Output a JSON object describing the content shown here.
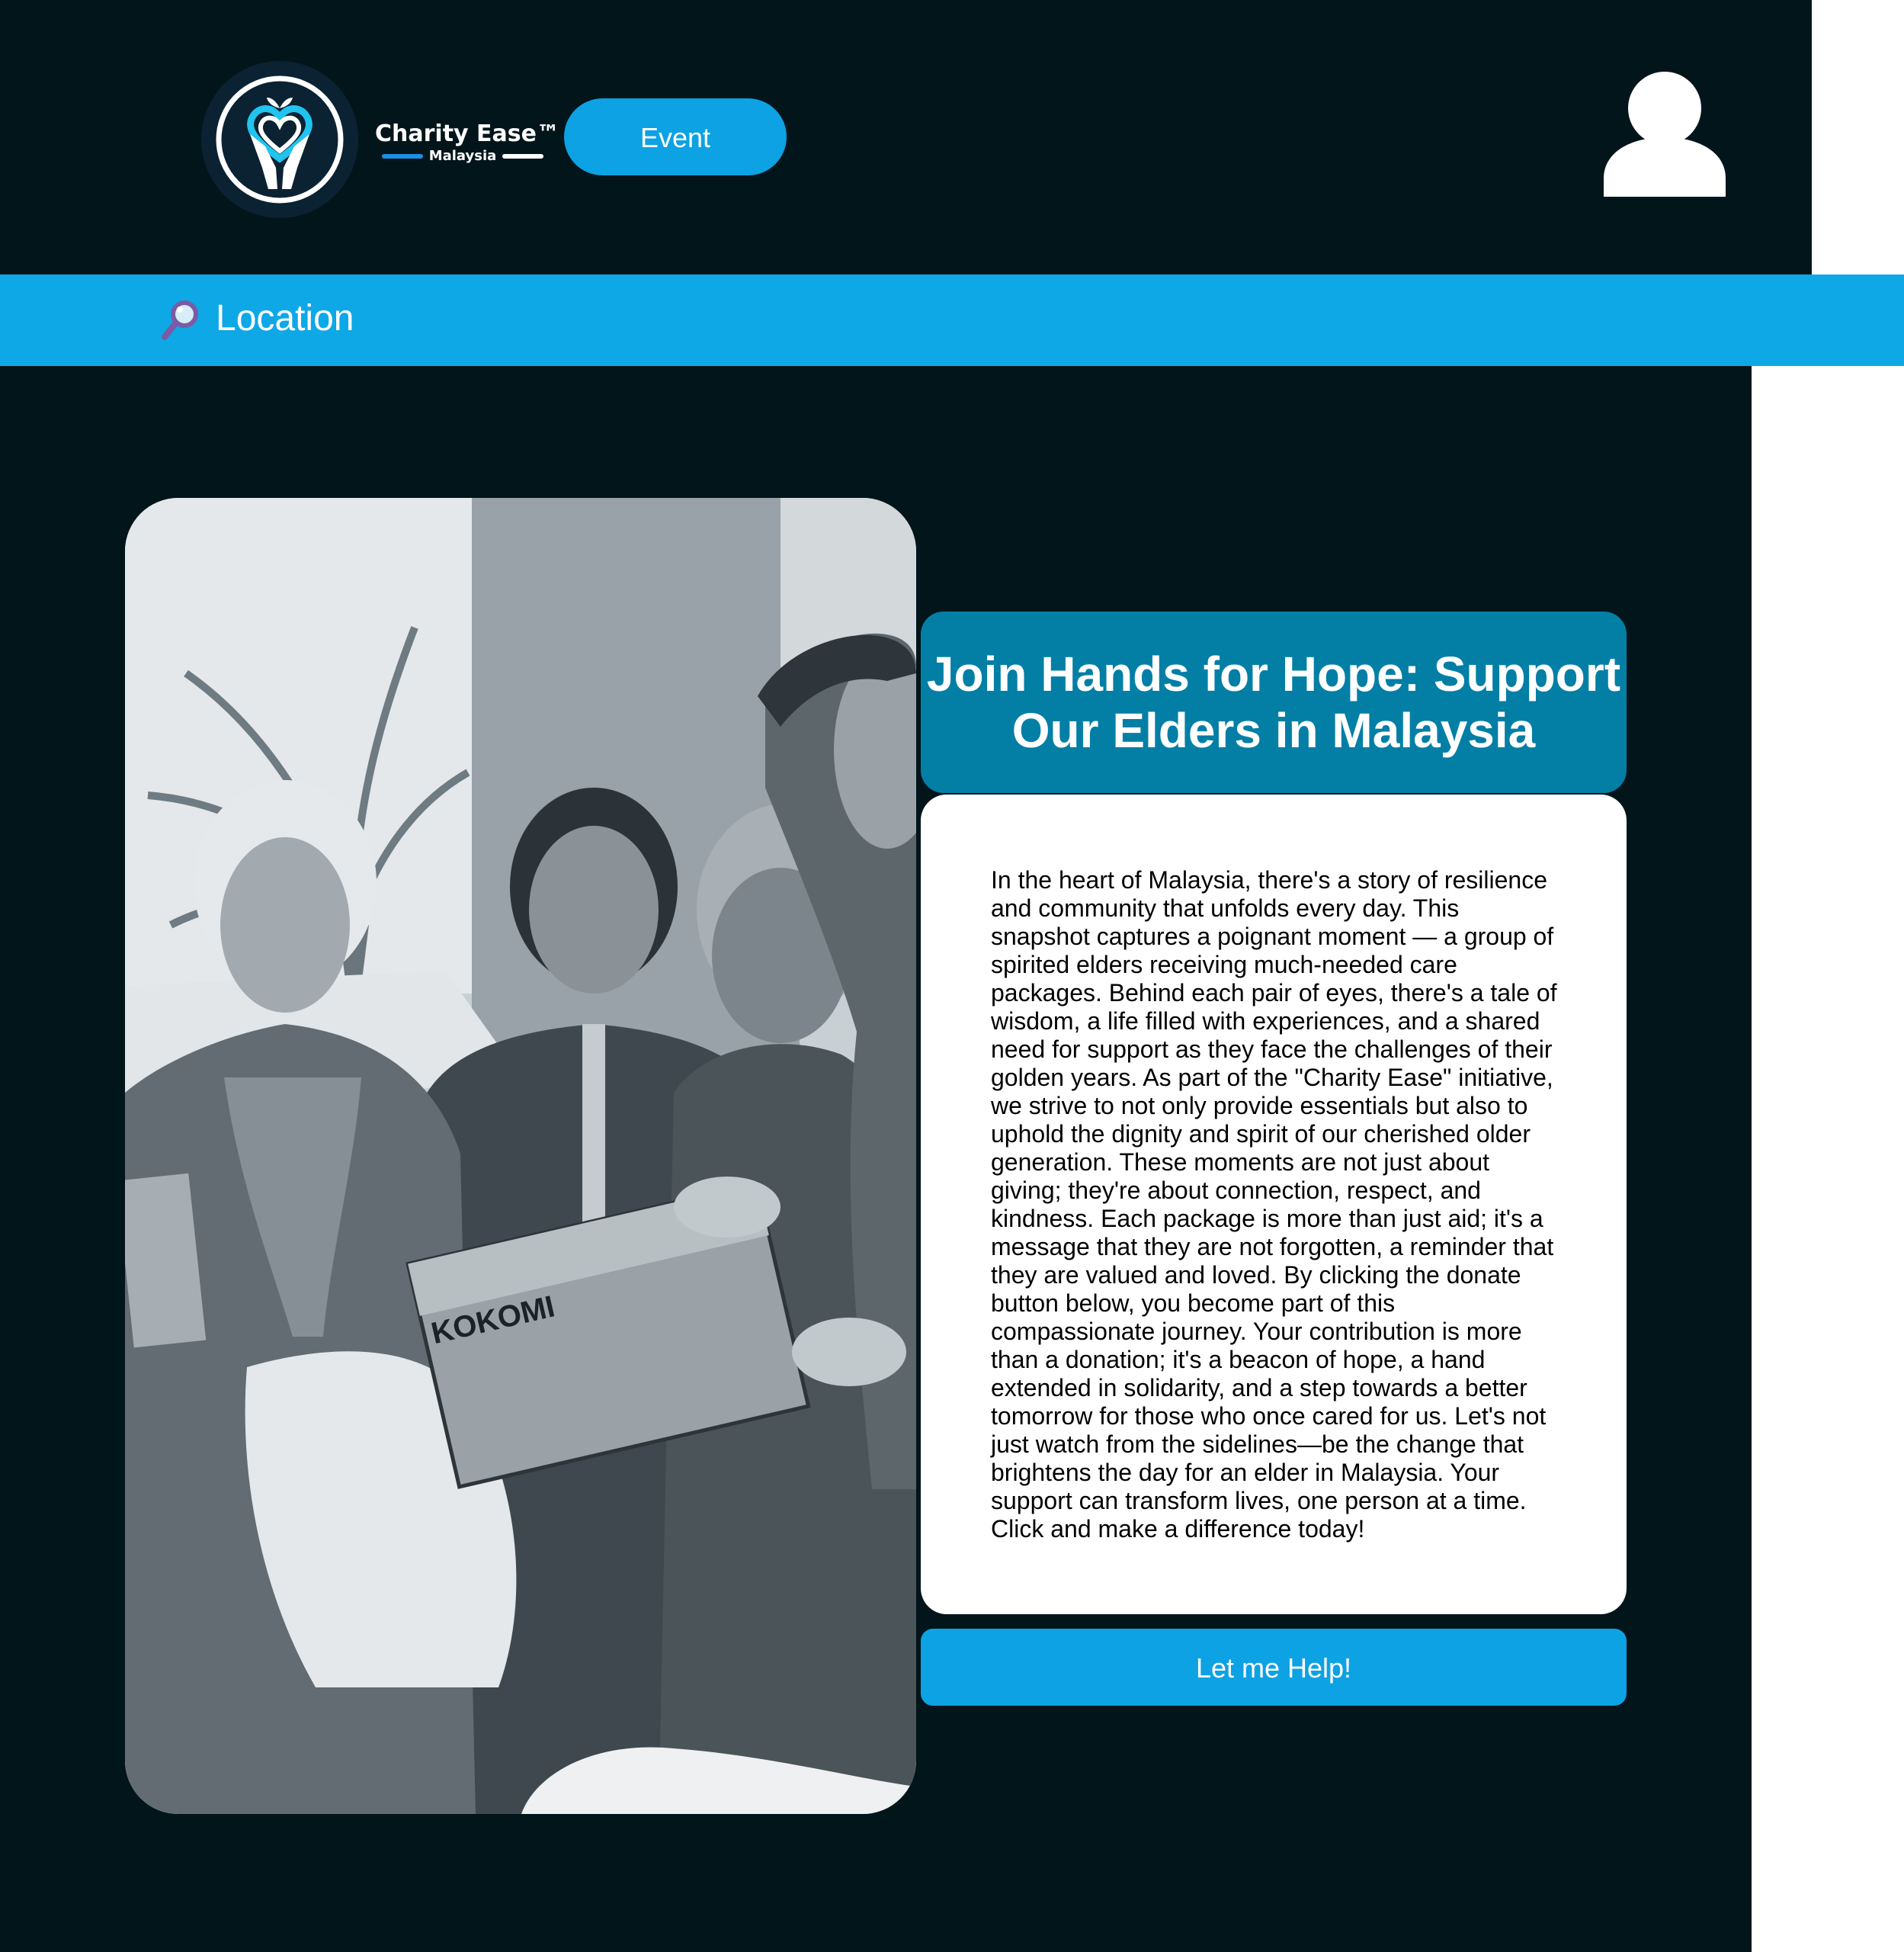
{
  "header": {
    "brand_name": "Charity Ease™",
    "brand_country": "Malaysia",
    "event_label": "Event"
  },
  "location_bar": {
    "label": "Location"
  },
  "main": {
    "title": "Join Hands for Hope: Support Our Elders in Malaysia",
    "body": "In the heart of Malaysia, there's a story of resilience and community that unfolds every day. This snapshot captures a poignant moment — a group of spirited elders receiving much-needed care packages. Behind each pair of eyes, there's a tale of wisdom, a life filled with experiences, and a shared need for support as they face the challenges of their golden years. As part of the \"Charity Ease\" initiative, we strive to not only provide essentials but also to uphold the dignity and spirit of our cherished older generation. These moments are not just about giving; they're about connection, respect, and kindness. Each package is more than just aid; it's a message that they are not forgotten, a reminder that they are valued and loved. By clicking the donate button below, you become part of this compassionate journey. Your contribution is more than a donation; it's a beacon of hope, a hand extended in solidarity, and a step towards a better tomorrow for those who once cared for us. Let's not just watch from the sidelines—be the change that brightens the day for an elder in Malaysia. Your support can transform lives, one person at a time. Click and make a difference today!",
    "photo_box_text": "KOKOMI",
    "help_label": "Let me Help!"
  },
  "icons": {
    "logo": "heart-hands-logo",
    "profile": "user-icon",
    "search": "search-icon"
  },
  "colors": {
    "header_bg": "#02151b",
    "accent": "#0ca2e3",
    "location_bar": "#0ea8e6",
    "title_bg": "#037fa6"
  }
}
